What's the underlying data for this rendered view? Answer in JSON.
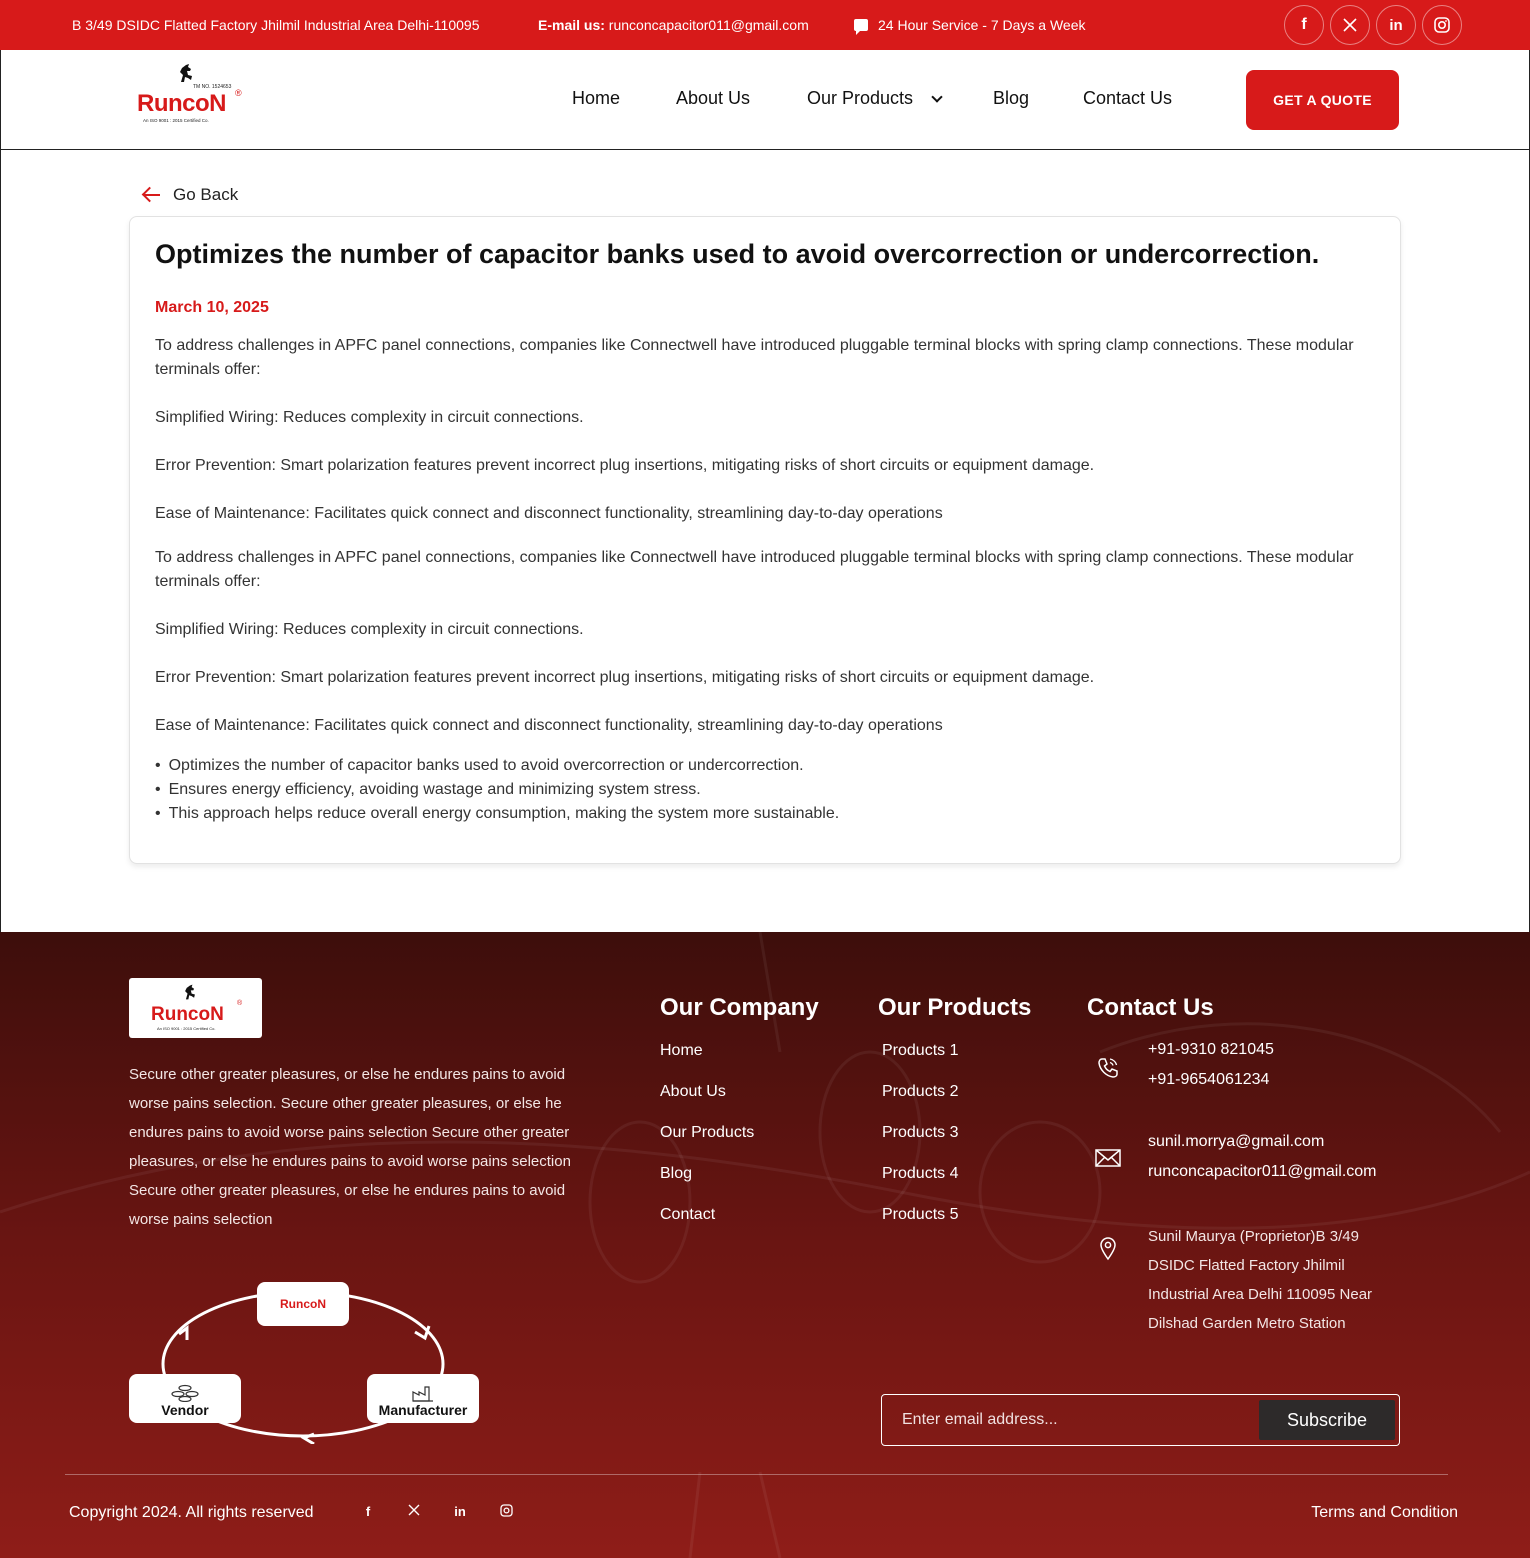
{
  "topbar": {
    "address": "B 3/49 DSIDC Flatted Factory Jhilmil Industrial Area Delhi-110095",
    "email_label": "E-mail us:",
    "email": "runconcapacitor011@gmail.com",
    "service": "24 Hour Service - 7 Days a Week",
    "socials": [
      "facebook-icon",
      "x-icon",
      "linkedin-icon",
      "instagram-icon"
    ]
  },
  "brand": {
    "name": "RunCon",
    "word": "RuncoN",
    "tm": "TM NO. 1524653",
    "iso": "An ISO 9001 : 2015 Certified Co."
  },
  "nav": {
    "home": "Home",
    "about": "About Us",
    "products": "Our Products",
    "blog": "Blog",
    "contact": "Contact Us",
    "quote": "GET A QUOTE"
  },
  "article": {
    "back": "Go Back",
    "title": "Optimizes the number of capacitor banks used to avoid overcorrection or undercorrection.",
    "date": "March 10, 2025",
    "p1": "To address challenges in APFC panel connections, companies like Connectwell have introduced pluggable terminal blocks with spring clamp connections. These modular terminals offer:",
    "p2": "Simplified Wiring: Reduces complexity in circuit connections.",
    "p3": "Error Prevention: Smart polarization features prevent incorrect plug insertions, mitigating risks of short circuits or equipment damage.",
    "p4": "Ease of Maintenance: Facilitates quick connect and disconnect functionality, streamlining day-to-day operations",
    "p5": "To address challenges in APFC panel connections, companies like Connectwell have introduced pluggable terminal blocks with spring clamp connections. These modular terminals offer:",
    "p6": "Simplified Wiring: Reduces complexity in circuit connections.",
    "p7": "Error Prevention: Smart polarization features prevent incorrect plug insertions, mitigating risks of short circuits or equipment damage.",
    "p8": "Ease of Maintenance: Facilitates quick connect and disconnect functionality, streamlining day-to-day operations",
    "bullets": [
      "Optimizes the number of capacitor banks used to avoid overcorrection or undercorrection.",
      "Ensures energy efficiency, avoiding wastage and minimizing system stress.",
      "This approach helps reduce overall energy consumption, making the system more sustainable."
    ]
  },
  "footer": {
    "description": "Secure other greater pleasures, or else he endures pains to avoid worse pains selection. Secure other greater pleasures, or else he endures pains to avoid worse pains selection Secure other greater pleasures, or else he endures pains to avoid worse pains selection Secure other greater pleasures, or else he endures pains to avoid worse pains selection",
    "cycle": {
      "vendor": "Vendor",
      "manufacturer": "Manufacturer"
    },
    "company_title": "Our Company",
    "company_links": [
      "Home",
      "About Us",
      "Our Products",
      "Blog",
      "Contact"
    ],
    "products_title": "Our Products",
    "product_links": [
      "Products 1",
      "Products 2",
      "Products 3",
      "Products 4",
      "Products 5"
    ],
    "contact_title": "Contact Us",
    "phone1": "+91-9310 821045",
    "phone2": "+91-9654061234",
    "email1": "sunil.morrya@gmail.com",
    "email2": "runconcapacitor011@gmail.com",
    "address": "Sunil Maurya (Proprietor)B 3/49 DSIDC Flatted Factory Jhilmil Industrial Area Delhi 110095 Near Dilshad Garden Metro Station",
    "email_placeholder": "Enter email address...",
    "subscribe": "Subscribe",
    "copyright": "Copyright 2024. All rights reserved",
    "terms": "Terms and Condition",
    "accent": "#d71a1a"
  }
}
